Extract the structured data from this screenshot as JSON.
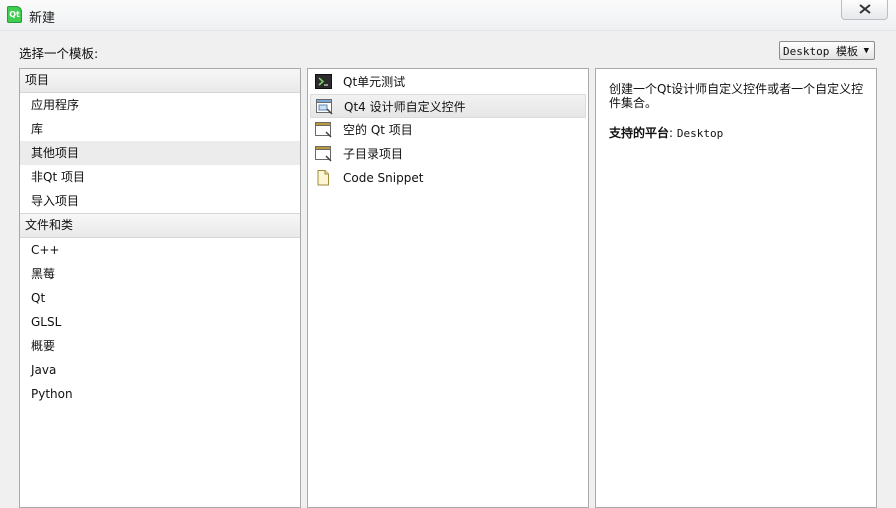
{
  "window": {
    "title": "新建",
    "close_symbol": "☒"
  },
  "chooser": {
    "label": "选择一个模板:",
    "filter_selected": "Desktop 模板"
  },
  "categories": [
    {
      "header": "项目",
      "items": [
        "应用程序",
        "库",
        "其他项目",
        "非Qt 项目",
        "导入项目"
      ],
      "selected_index": 2
    },
    {
      "header": "文件和类",
      "items": [
        "C++",
        "黑莓",
        "Qt",
        "GLSL",
        "概要",
        "Java",
        "Python"
      ]
    }
  ],
  "templates": [
    {
      "label": "Qt单元测试",
      "icon": "terminal-icon"
    },
    {
      "label": "Qt4 设计师自定义控件",
      "icon": "designer-widget-icon",
      "selected": true
    },
    {
      "label": "空的 Qt 项目",
      "icon": "window-icon"
    },
    {
      "label": "子目录项目",
      "icon": "window-icon"
    },
    {
      "label": "Code Snippet",
      "icon": "document-icon"
    }
  ],
  "description": {
    "text": "创建一个Qt设计师自定义控件或者一个自定义控件集合。",
    "platform_label": "支持的平台",
    "platform_value": "Desktop"
  }
}
